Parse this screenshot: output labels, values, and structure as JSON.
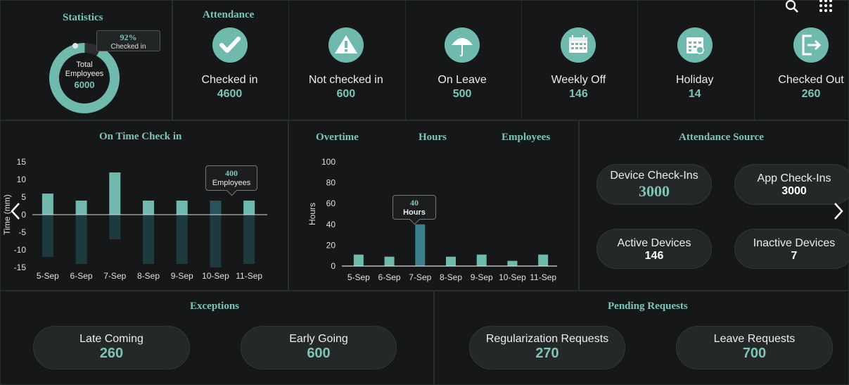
{
  "header": {
    "search_icon": "search-icon",
    "apps_icon": "apps-grid-icon"
  },
  "statistics": {
    "title": "Statistics",
    "percent": "92%",
    "percent_label": "Checked in",
    "total_label_1": "Total",
    "total_label_2": "Employees",
    "total_value": "6000",
    "checked_in_fraction": 0.92
  },
  "attendance": {
    "title": "Attendance",
    "items": [
      {
        "label": "Checked in",
        "value": "4600",
        "icon": "check-icon"
      },
      {
        "label": "Not checked in",
        "value": "600",
        "icon": "warning-icon"
      },
      {
        "label": "On Leave",
        "value": "500",
        "icon": "umbrella-icon"
      },
      {
        "label": "Weekly Off",
        "value": "146",
        "icon": "calendar-icon"
      },
      {
        "label": "Holiday",
        "value": "14",
        "icon": "holiday-calendar-icon"
      },
      {
        "label": "Checked Out",
        "value": "260",
        "icon": "exit-icon"
      }
    ]
  },
  "ontime": {
    "title": "On Time Check in",
    "tooltip_value": "400",
    "tooltip_label": "Employees"
  },
  "overtime": {
    "tab_overtime": "Overtime",
    "tab_hours": "Hours",
    "tab_employees": "Employees",
    "tooltip_value": "40",
    "tooltip_label": "Hours"
  },
  "source": {
    "title": "Attendance Source",
    "device_label": "Device Check-Ins",
    "device_value": "3000",
    "app_label": "App Check-Ins",
    "app_value": "3000",
    "active_label": "Active Devices",
    "active_value": "146",
    "inactive_label": "Inactive Devices",
    "inactive_value": "7"
  },
  "exceptions": {
    "title": "Exceptions",
    "late_label": "Late Coming",
    "late_value": "260",
    "early_label": "Early Going",
    "early_value": "600"
  },
  "pending": {
    "title": "Pending Requests",
    "reg_label": "Regularization Requests",
    "reg_value": "270",
    "leave_label": "Leave Requests",
    "leave_value": "700"
  },
  "colors": {
    "accent": "#7fc4b8",
    "bar_dark": "#1e3a3e",
    "bar_mid": "#3b7f8c"
  },
  "chart_data": [
    {
      "type": "bar",
      "categories": [
        "5-Sep",
        "6-Sep",
        "7-Sep",
        "8-Sep",
        "9-Sep",
        "10-Sep",
        "11-Sep"
      ],
      "series": [
        {
          "values": [
            6,
            4,
            12,
            4,
            4,
            4,
            4
          ]
        },
        {
          "values": [
            -12,
            -14,
            -7,
            -14,
            -14,
            -15,
            -14
          ]
        }
      ],
      "title": "On Time Check in",
      "ylabel": "Time (mm)",
      "ylim": [
        -15,
        15
      ],
      "yticks": [
        15,
        10,
        5,
        0,
        -5,
        -10,
        -15
      ]
    },
    {
      "type": "bar",
      "categories": [
        "5-Sep",
        "6-Sep",
        "7-Sep",
        "8-Sep",
        "9-Sep",
        "10-Sep",
        "11-Sep"
      ],
      "values": [
        11,
        9,
        40,
        9,
        11,
        5,
        11
      ],
      "ylabel": "Hours",
      "ylim": [
        0,
        100
      ],
      "yticks": [
        100,
        80,
        60,
        40,
        20,
        0
      ]
    }
  ]
}
